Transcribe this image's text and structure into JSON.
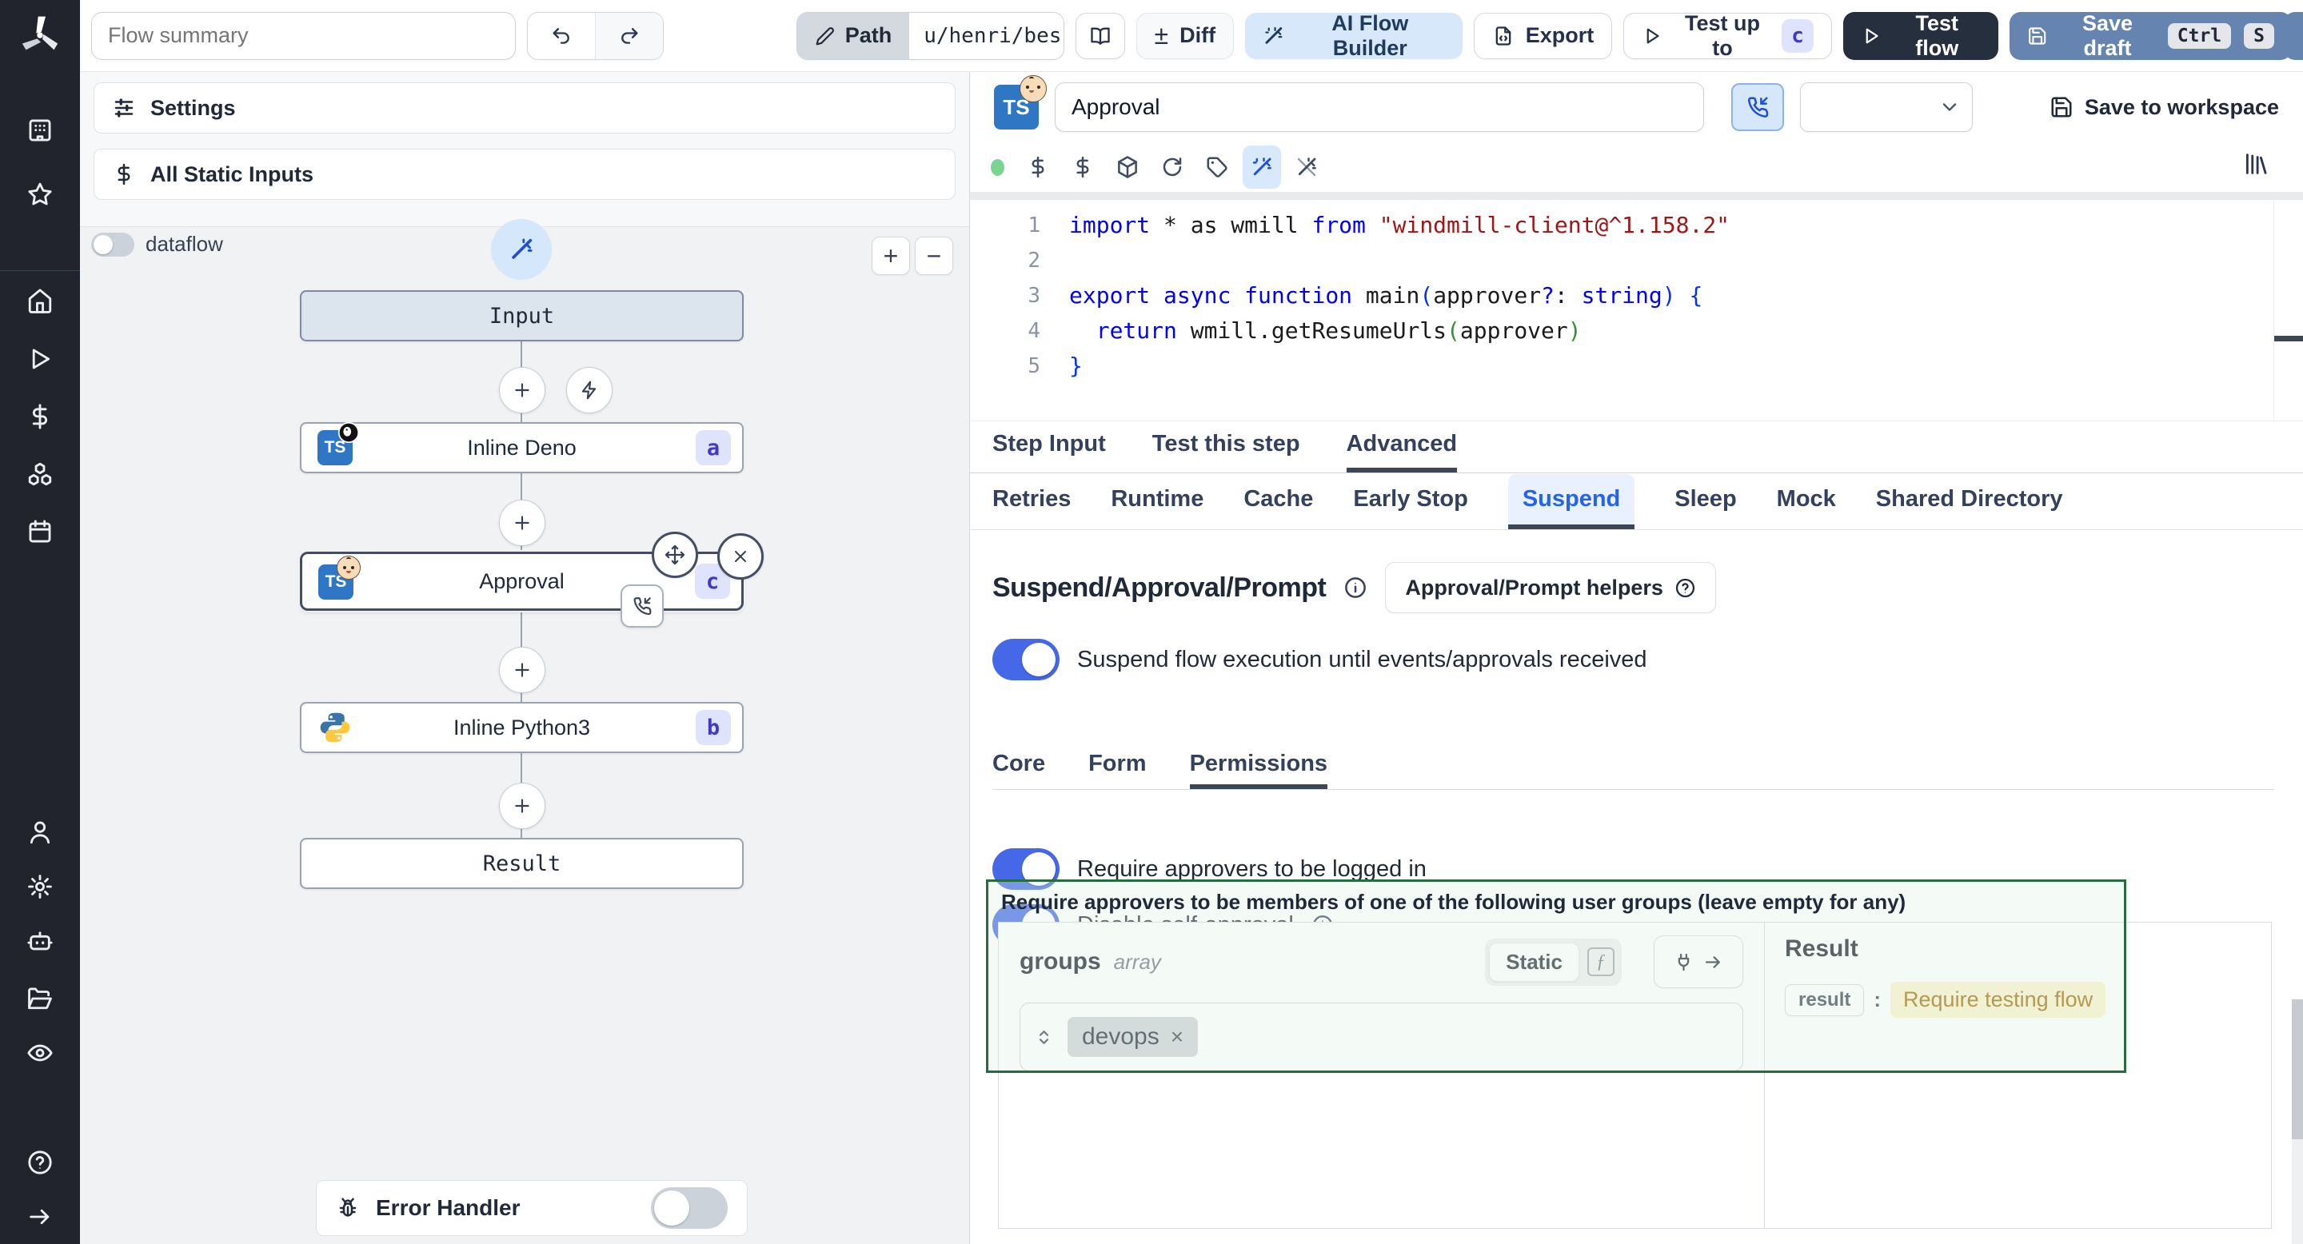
{
  "topbar": {
    "flow_summary_placeholder": "Flow summary",
    "path_label": "Path",
    "path_value": "u/henri/bes",
    "diff_label": "Diff",
    "diff_glyph": "±",
    "ai_flow_builder_label": "AI Flow Builder",
    "export_label": "Export",
    "test_up_to_label": "Test up to",
    "test_up_to_badge": "c",
    "test_flow_label": "Test flow",
    "save_draft_label": "Save draft",
    "save_draft_kbd": [
      "Ctrl",
      "S"
    ]
  },
  "sidebar": {
    "icons": [
      "windmill-logo",
      "building-icon",
      "star-icon",
      "home-icon",
      "play-icon",
      "dollar-icon",
      "cubes-icon",
      "calendar-icon",
      "user-icon",
      "gear-icon",
      "robot-icon",
      "folder-icon",
      "eye-icon",
      "help-icon",
      "arrow-right-icon"
    ]
  },
  "left_panel": {
    "settings_label": "Settings",
    "all_static_inputs_label": "All Static Inputs",
    "dataflow_label": "dataflow",
    "dataflow_on": false,
    "zoom_in": "+",
    "zoom_out": "−",
    "error_handler_label": "Error Handler",
    "error_handler_on": false
  },
  "graph": {
    "nodes": [
      {
        "label": "Input",
        "type": "input"
      },
      {
        "label": "Inline Deno",
        "badge": "a",
        "lang": "deno"
      },
      {
        "label": "Approval",
        "badge": "c",
        "lang": "deno-approval",
        "selected": true
      },
      {
        "label": "Inline Python3",
        "badge": "b",
        "lang": "python3"
      },
      {
        "label": "Result",
        "type": "result"
      }
    ]
  },
  "step_editor": {
    "step_title_value": "Approval",
    "language_select_value": "",
    "save_to_workspace_label": "Save to workspace",
    "code": {
      "lines": [
        [
          [
            "kw",
            "import"
          ],
          [
            "pl",
            " * as wmill "
          ],
          [
            "kw",
            "from"
          ],
          [
            "pl",
            " "
          ],
          [
            "str",
            "\"windmill-client@^1.158.2\""
          ]
        ],
        [],
        [
          [
            "kw",
            "export"
          ],
          [
            "pl",
            " "
          ],
          [
            "kw",
            "async"
          ],
          [
            "pl",
            " "
          ],
          [
            "kw",
            "function"
          ],
          [
            "pl",
            " main"
          ],
          [
            "b1",
            "("
          ],
          [
            "pl",
            "approver"
          ],
          [
            "kw",
            "?"
          ],
          [
            "pl",
            ": "
          ],
          [
            "kw",
            "string"
          ],
          [
            "b1",
            ")"
          ],
          [
            "pl",
            " "
          ],
          [
            "b1",
            "{"
          ]
        ],
        [
          [
            "pl",
            "  "
          ],
          [
            "kw",
            "return"
          ],
          [
            "pl",
            " wmill.getResumeUrls"
          ],
          [
            "b2",
            "("
          ],
          [
            "pl",
            "approver"
          ],
          [
            "b2",
            ")"
          ]
        ],
        [
          [
            "b1",
            "}"
          ]
        ]
      ]
    },
    "tabs": {
      "items": [
        "Step Input",
        "Test this step",
        "Advanced"
      ],
      "active": "Advanced"
    },
    "advanced_tabs": {
      "items": [
        "Retries",
        "Runtime",
        "Cache",
        "Early Stop",
        "Suspend",
        "Sleep",
        "Mock",
        "Shared Directory"
      ],
      "active": "Suspend"
    },
    "suspend": {
      "heading": "Suspend/Approval/Prompt",
      "helpers_button_label": "Approval/Prompt helpers",
      "suspend_toggle_label": "Suspend flow execution until events/approvals received",
      "suspend_toggle_on": true,
      "sub_tabs": {
        "items": [
          "Core",
          "Form",
          "Permissions"
        ],
        "active": "Permissions"
      },
      "require_logged_in_label": "Require approvers to be logged in",
      "require_logged_in_on": true,
      "disable_self_approval_label": "Disable self-approval",
      "disable_self_approval_on": true,
      "groups_box": {
        "title": "Require approvers to be members of one of the following user groups (leave empty for any)",
        "field_name": "groups",
        "field_type": "array",
        "static_label": "Static",
        "fn_glyph": "ƒ",
        "chips": [
          "devops"
        ],
        "chip_remove_glyph": "×",
        "result_heading": "Result",
        "result_key": "result",
        "result_colon": ":",
        "result_value": "Require testing flow"
      }
    }
  },
  "colors": {
    "accent_toggle_on": "#4468e8",
    "ai_button_bg": "#d8e8fb",
    "save_draft_bg": "#6584b0",
    "test_flow_bg": "#262f3e",
    "badge_bg": "#dfe3fc",
    "badge_text": "#4338ca",
    "green_box_border": "#266d3d",
    "result_value_bg": "#fbf3cd",
    "result_value_text": "#9d6a06",
    "status_dot": "#7cd492",
    "keyword": "#0000ff",
    "string": "#a31515",
    "bracket1": "#0431fa",
    "bracket2": "#319331"
  }
}
